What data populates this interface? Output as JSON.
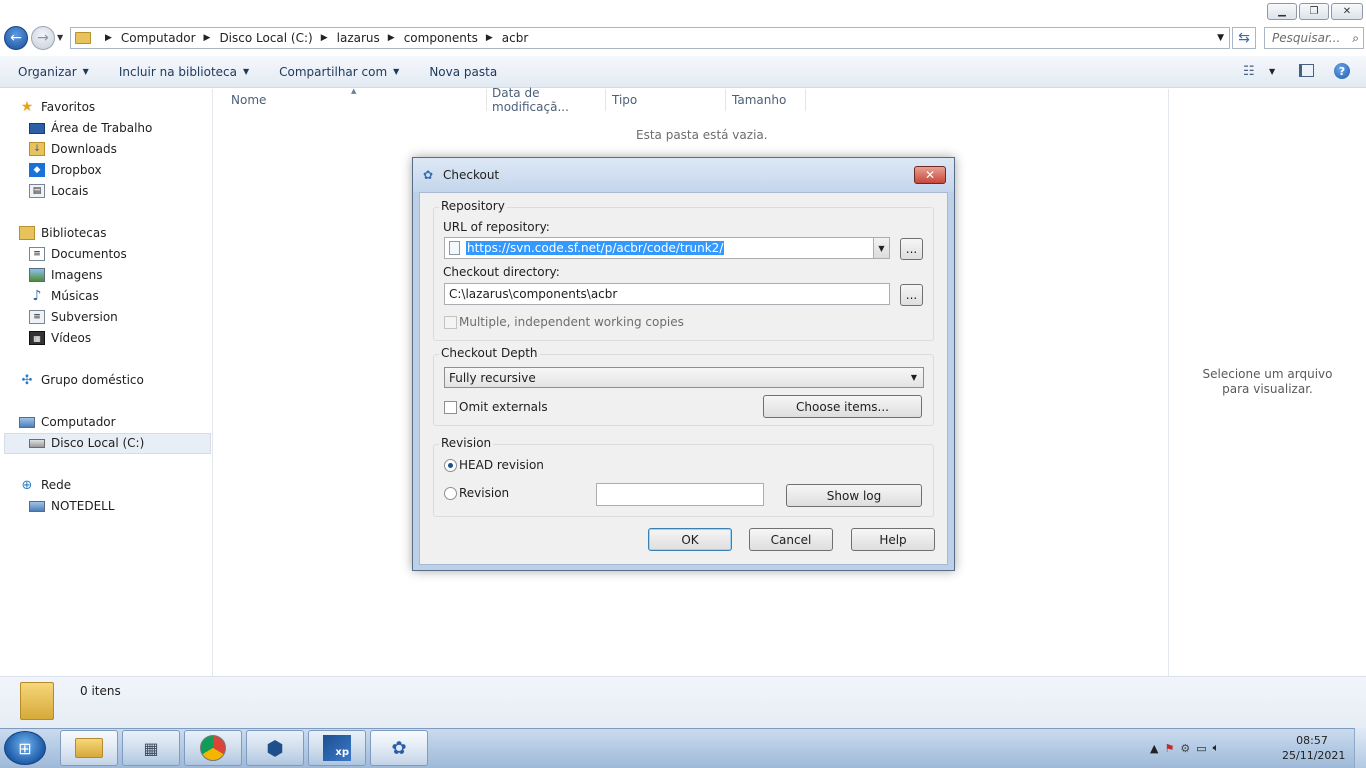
{
  "address": {
    "crumbs": [
      "Computador",
      "Disco Local (C:)",
      "lazarus",
      "components",
      "acbr"
    ],
    "search_placeholder": "Pesquisar..."
  },
  "toolbar": {
    "organize": "Organizar",
    "include_library": "Incluir na biblioteca",
    "share_with": "Compartilhar com",
    "new_folder": "Nova pasta"
  },
  "nav": {
    "favorites": "Favoritos",
    "desktop": "Área de Trabalho",
    "downloads": "Downloads",
    "dropbox": "Dropbox",
    "locals": "Locais",
    "libraries": "Bibliotecas",
    "documents": "Documentos",
    "images": "Imagens",
    "music": "Músicas",
    "subversion": "Subversion",
    "videos": "Vídeos",
    "homegroup": "Grupo doméstico",
    "computer": "Computador",
    "local_disk": "Disco Local (C:)",
    "network": "Rede",
    "notedell": "NOTEDELL"
  },
  "columns": {
    "name": "Nome",
    "date_modified": "Data de modificaçã...",
    "type": "Tipo",
    "size": "Tamanho"
  },
  "content": {
    "empty_text": "Esta pasta está vazia.",
    "preview_text": "Selecione um arquivo para visualizar."
  },
  "status": {
    "item_count": "0 itens"
  },
  "dialog": {
    "title": "Checkout",
    "repository_group": "Repository",
    "url_label": "URL of repository:",
    "url_value": "https://svn.code.sf.net/p/acbr/code/trunk2/",
    "dir_label": "Checkout directory:",
    "dir_value": "C:\\lazarus\\components\\acbr",
    "browse": "...",
    "multiple_copies": "Multiple, independent working copies",
    "depth_group": "Checkout Depth",
    "depth_value": "Fully recursive",
    "omit_externals": "Omit externals",
    "choose_items": "Choose items...",
    "revision_group": "Revision",
    "head_revision": "HEAD revision",
    "revision": "Revision",
    "revision_value": "",
    "show_log": "Show log",
    "ok": "OK",
    "cancel": "Cancel",
    "help": "Help"
  },
  "taskbar": {
    "time": "08:57",
    "date": "25/11/2021"
  },
  "colors": {
    "accent": "#3399ff",
    "taskbar": "#9eb9d8",
    "close_red": "#c7483a"
  }
}
